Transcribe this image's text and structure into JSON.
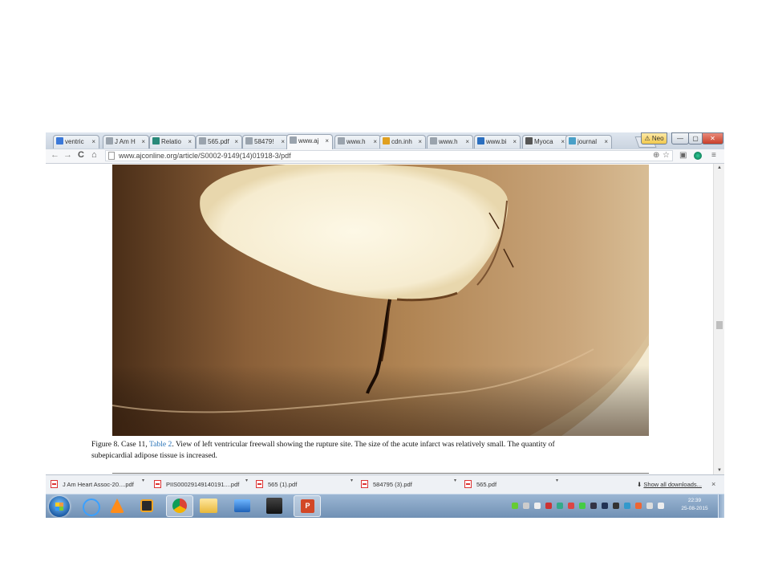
{
  "browser": {
    "tabs": [
      {
        "label": "ventric",
        "icon": "google-scholar-icon",
        "color": "#3b78d8"
      },
      {
        "label": "J Am H",
        "icon": "page-icon",
        "color": "#9aa3ad"
      },
      {
        "label": "Relatio",
        "icon": "ka-icon",
        "color": "#2a8a7a"
      },
      {
        "label": "565.pdf",
        "icon": "page-icon",
        "color": "#9aa3ad"
      },
      {
        "label": "58479!",
        "icon": "page-icon",
        "color": "#9aa3ad"
      },
      {
        "label": "www.aj",
        "icon": "page-icon",
        "color": "#9aa3ad",
        "active": true
      },
      {
        "label": "www.h",
        "icon": "page-icon",
        "color": "#9aa3ad"
      },
      {
        "label": "cdn.inh",
        "icon": "cdn-icon",
        "color": "#e0a020"
      },
      {
        "label": "www.h",
        "icon": "page-icon",
        "color": "#9aa3ad"
      },
      {
        "label": "www.bi",
        "icon": "globe-icon",
        "color": "#2c6fbf"
      },
      {
        "label": "Myoca",
        "icon": "wikipedia-icon",
        "color": "#555555"
      },
      {
        "label": "journal",
        "icon": "journal-icon",
        "color": "#4aa0c8"
      }
    ],
    "close_glyph": "×",
    "window_user_label": "Neo",
    "url": "www.ajconline.org/article/S0002-9149(14)01918-3/pdf"
  },
  "figure": {
    "prefix": "Figure 8. Case 11, ",
    "link": "Table 2",
    "rest_line1": ". View of left ventricular freewall showing the rupture site. The size of the acute infarct was relatively small. The quantity of",
    "line2": "subepicardial adipose tissue is increased."
  },
  "downloads": {
    "items": [
      {
        "label": "J Am Heart Assoc-20....pdf"
      },
      {
        "label": "PIIS00029149140191....pdf"
      },
      {
        "label": "565 (1).pdf"
      },
      {
        "label": "584795 (3).pdf"
      },
      {
        "label": "565.pdf"
      }
    ],
    "show_all": "Show all downloads...",
    "close": "×"
  },
  "taskbar": {
    "time": "22:39",
    "date": "25-08-2015"
  },
  "colors": {
    "link": "#2a74b8",
    "tissue_light": "#c9a57a",
    "tissue_dark": "#5e3d20"
  }
}
